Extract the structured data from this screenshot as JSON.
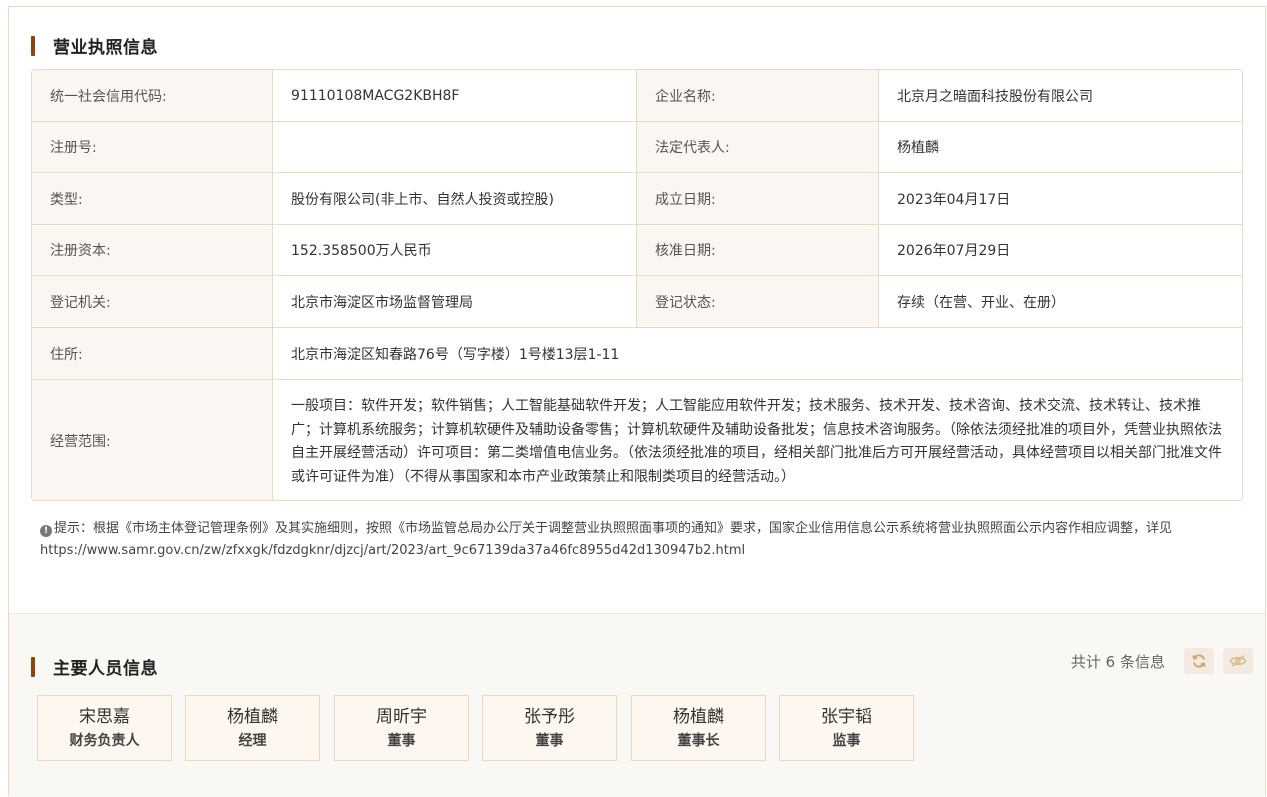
{
  "license": {
    "title": "营业执照信息",
    "rows": [
      {
        "l1": "统一社会信用代码:",
        "v1": "91110108MACG2KBH8F",
        "l2": "企业名称:",
        "v2": "北京月之暗面科技股份有限公司"
      },
      {
        "l1": "注册号:",
        "v1": "",
        "l2": "法定代表人:",
        "v2": "杨植麟"
      },
      {
        "l1": "类型:",
        "v1": "股份有限公司(非上市、自然人投资或控股)",
        "l2": "成立日期:",
        "v2": "2023年04月17日"
      },
      {
        "l1": "注册资本:",
        "v1": "152.358500万人民币",
        "l2": "核准日期:",
        "v2": "2026年07月29日"
      },
      {
        "l1": "登记机关:",
        "v1": "北京市海淀区市场监督管理局",
        "l2": "登记状态:",
        "v2": "存续（在营、开业、在册）"
      }
    ],
    "address_label": "住所:",
    "address_value": "北京市海淀区知春路76号（写字楼）1号楼13层1-11",
    "scope_label": "经营范围:",
    "scope_value": "一般项目：软件开发；软件销售；人工智能基础软件开发；人工智能应用软件开发；技术服务、技术开发、技术咨询、技术交流、技术转让、技术推广；计算机系统服务；计算机软硬件及辅助设备零售；计算机软硬件及辅助设备批发；信息技术咨询服务。（除依法须经批准的项目外，凭营业执照依法自主开展经营活动）许可项目：第二类增值电信业务。（依法须经批准的项目，经相关部门批准后方可开展经营活动，具体经营项目以相关部门批准文件或许可证件为准）（不得从事国家和本市产业政策禁止和限制类项目的经营活动。）"
  },
  "tip": {
    "icon": "info-icon",
    "text": "提示：根据《市场主体登记管理条例》及其实施细则，按照《市场监管总局办公厅关于调整营业执照照面事项的通知》要求，国家企业信用信息公示系统将营业执照照面公示内容作相应调整，详见",
    "url": "https://www.samr.gov.cn/zw/zfxxgk/fdzdgknr/djzcj/art/2023/art_9c67139da37a46fc8955d42d130947b2.html"
  },
  "personnel": {
    "title": "主要人员信息",
    "count_text": "共计 6 条信息",
    "icons": [
      "refresh-icon",
      "hide-eye-icon"
    ],
    "people": [
      {
        "name": "宋思嘉",
        "role": "财务负责人"
      },
      {
        "name": "杨植麟",
        "role": "经理"
      },
      {
        "name": "周昕宇",
        "role": "董事"
      },
      {
        "name": "张予彤",
        "role": "董事"
      },
      {
        "name": "杨植麟",
        "role": "董事长"
      },
      {
        "name": "张宇韬",
        "role": "监事"
      }
    ]
  },
  "colors": {
    "accent": "#8b4513",
    "border": "#ecd9c2",
    "label_bg": "#faf7f3",
    "card_bg": "#fdf7ef"
  }
}
